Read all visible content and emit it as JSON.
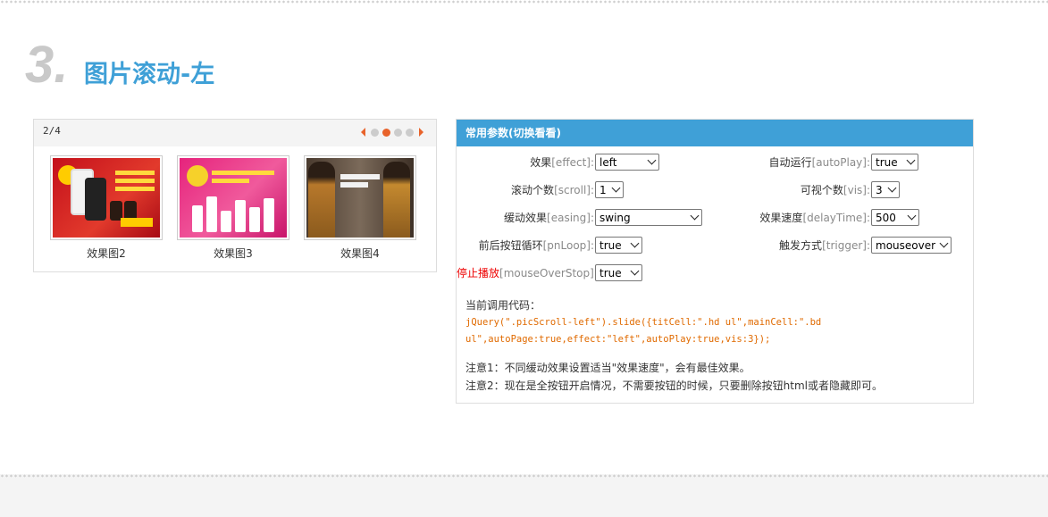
{
  "section": {
    "number": "3.",
    "title": "图片滚动-左"
  },
  "demo": {
    "pager_text": "2/4",
    "pager_active": 2,
    "pager_count": 4,
    "slides": [
      {
        "caption": "效果图2"
      },
      {
        "caption": "效果图3"
      },
      {
        "caption": "效果图4"
      }
    ]
  },
  "panel": {
    "header": "常用参数(切换看看)",
    "params": {
      "effect": {
        "cn": "效果",
        "en": "[effect]:",
        "value": "left"
      },
      "autoPlay": {
        "cn": "自动运行",
        "en": "[autoPlay]:",
        "value": "true"
      },
      "scroll": {
        "cn": "滚动个数",
        "en": "[scroll]:",
        "value": "1"
      },
      "vis": {
        "cn": "可视个数",
        "en": "[vis]:",
        "value": "3"
      },
      "easing": {
        "cn": "缓动效果",
        "en": "[easing]:",
        "value": "swing"
      },
      "delayTime": {
        "cn": "效果速度",
        "en": "[delayTime]:",
        "value": "500"
      },
      "pnLoop": {
        "cn": "前后按钮循环",
        "en": "[pnLoop]:",
        "value": "true"
      },
      "trigger": {
        "cn": "触发方式",
        "en": "[trigger]:",
        "value": "mouseover"
      },
      "mouseOverStop": {
        "cn": "停止播放",
        "en": "[mouseOverStop]:",
        "value": "true"
      }
    },
    "code_label": "当前调用代码：",
    "code": "jQuery(\".picScroll-left\").slide({titCell:\".hd ul\",mainCell:\".bd ul\",autoPage:true,effect:\"left\",autoPlay:true,vis:3});",
    "note1": "注意1：不同缓动效果设置适当\"效果速度\"，会有最佳效果。",
    "note2": "注意2：现在是全按钮开启情况，不需要按钮的时候，只要删除按钮html或者隐藏即可。"
  },
  "colors": {
    "accent": "#3fa0d7",
    "pager_active": "#e8632b",
    "code": "#e06a00",
    "highlight": "#ee0000"
  }
}
